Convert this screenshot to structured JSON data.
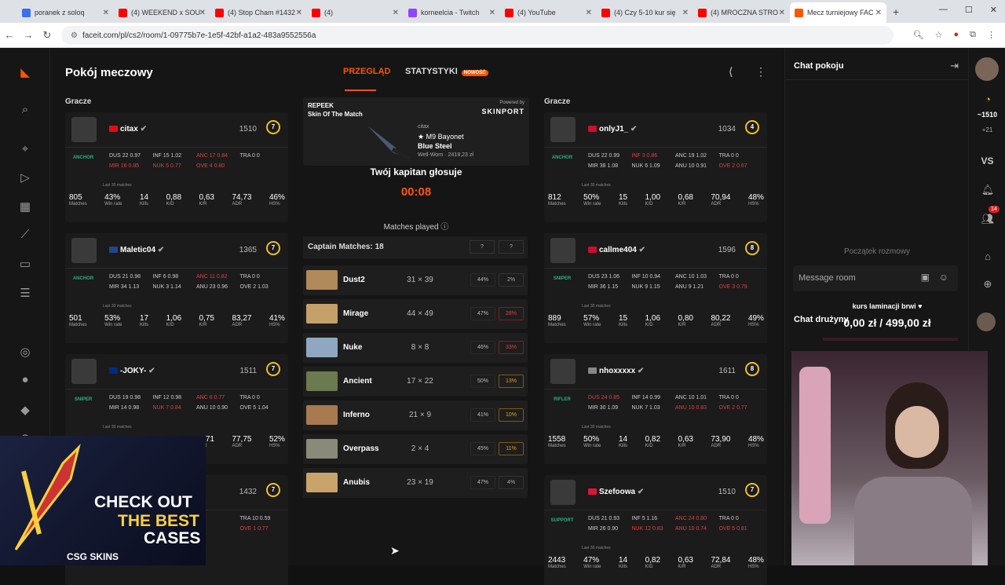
{
  "browser": {
    "tabs": [
      {
        "title": "poranek z soloq",
        "color": "#3b6ef0"
      },
      {
        "title": "(4) WEEKEND x SOU",
        "color": "#ff0000"
      },
      {
        "title": "(4) Stop Cham #1432",
        "color": "#ff0000"
      },
      {
        "title": "(4)",
        "color": "#ff0000"
      },
      {
        "title": "korneelcia - Twitch",
        "color": "#9146ff"
      },
      {
        "title": "(4) YouTube",
        "color": "#ff0000"
      },
      {
        "title": "(4) Czy 5-10 kur się",
        "color": "#ff0000"
      },
      {
        "title": "(4) MROCZNA STRO",
        "color": "#ff0000"
      },
      {
        "title": "Mecz turniejowy FAC",
        "color": "#ff5500"
      }
    ],
    "url": "faceit.com/pl/cs2/room/1-09775b7e-1e5f-42bf-a1a2-483a9552556a"
  },
  "page": {
    "title": "Pokój meczowy",
    "tab_overview": "PRZEGLĄD",
    "tab_stats": "STATYSTYKI",
    "tab_new": "NOWOŚĆ",
    "players_label": "Gracze"
  },
  "team_left": [
    {
      "name": "citax",
      "elo": "1510",
      "level": "7",
      "role": "ANCHOR",
      "flag": "#e30a17",
      "maps": [
        "DUS 22 0.97",
        "INF 15 1.02",
        "ANC 17 0.84",
        "TRA 0 0",
        "MIR 16 0.85",
        "NUK 5 0.77",
        "OVE 4 0.80",
        ""
      ],
      "last": "Last 30 matches",
      "stats": [
        [
          "805",
          "Matches"
        ],
        [
          "43%",
          "Win rate"
        ],
        [
          "14",
          "Kills"
        ],
        [
          "0,88",
          "K/D"
        ],
        [
          "0,63",
          "K/R"
        ],
        [
          "74,73",
          "ADR"
        ],
        [
          "46%",
          "HS%"
        ]
      ]
    },
    {
      "name": "Maletic04",
      "elo": "1365",
      "level": "7",
      "role": "ANCHOR",
      "flag": "#21468b",
      "maps": [
        "DUS 21 0.98",
        "INF 6 0.98",
        "ANC 11 0.82",
        "TRA 0 0",
        "MIR 34 1.13",
        "NUK 3 1.14",
        "ANU 23 0.96",
        "OVE 2 1.03"
      ],
      "last": "Last 30 matches",
      "stats": [
        [
          "501",
          "Matches"
        ],
        [
          "53%",
          "Win rate"
        ],
        [
          "17",
          "Kills"
        ],
        [
          "1,06",
          "K/D"
        ],
        [
          "0,75",
          "K/R"
        ],
        [
          "83,27",
          "ADR"
        ],
        [
          "41%",
          "HS%"
        ]
      ]
    },
    {
      "name": "-JOKY-",
      "elo": "1511",
      "level": "7",
      "role": "SNIPER",
      "flag": "#002b7f",
      "maps": [
        "DUS 19 0.98",
        "INF 12 0.98",
        "ANC 6 0.77",
        "TRA 0 0",
        "MIR 14 0.98",
        "NUK 7 0.84",
        "ANU 10 0.90",
        "OVE 5 1.04"
      ],
      "last": "Last 30 matches",
      "stats": [
        [
          "1247",
          "Matches"
        ],
        [
          "43%",
          "Win rate"
        ],
        [
          "16",
          "Kills"
        ],
        [
          "1,00",
          "K/D"
        ],
        [
          "0,71",
          "K/R"
        ],
        [
          "77,75",
          "ADR"
        ],
        [
          "52%",
          "HS%"
        ]
      ]
    },
    {
      "name": "",
      "elo": "1432",
      "level": "7",
      "role": "",
      "flag": "#333",
      "maps": [
        "",
        "",
        "",
        "TRA 10 0.59",
        "",
        "",
        "",
        "OVE 1 0.77"
      ],
      "last": "",
      "stats": []
    }
  ],
  "team_right": [
    {
      "name": "onlyJ1_",
      "elo": "1034",
      "level": "4",
      "role": "ANCHOR",
      "flag": "#c8102e",
      "maps": [
        "DUS 22 0.99",
        "INF 3 0.86",
        "ANC 19 1.02",
        "TRA 0 0",
        "MIR 38 1.08",
        "NUK 6 1.09",
        "ANU 10 0.91",
        "OVE 2 0.67"
      ],
      "last": "Last 30 matches",
      "stats": [
        [
          "812",
          "Matches"
        ],
        [
          "50%",
          "Win rate"
        ],
        [
          "15",
          "Kills"
        ],
        [
          "1,00",
          "K/D"
        ],
        [
          "0,68",
          "K/R"
        ],
        [
          "70,94",
          "ADR"
        ],
        [
          "48%",
          "HS%"
        ]
      ]
    },
    {
      "name": "callme404",
      "elo": "1596",
      "level": "8",
      "role": "SNIPER",
      "flag": "#c8102e",
      "maps": [
        "DUS 23 1.06",
        "INF 10 0.94",
        "ANC 10 1.03",
        "TRA 0 0",
        "MIR 36 1.15",
        "NUK 9 1.15",
        "ANU 9 1.21",
        "OVE 3 0.79"
      ],
      "last": "Last 30 matches",
      "stats": [
        [
          "889",
          "Matches"
        ],
        [
          "57%",
          "Win rate"
        ],
        [
          "15",
          "Kills"
        ],
        [
          "1,06",
          "K/D"
        ],
        [
          "0,80",
          "K/R"
        ],
        [
          "80,22",
          "ADR"
        ],
        [
          "49%",
          "HS%"
        ]
      ]
    },
    {
      "name": "nhoxxxxx",
      "elo": "1611",
      "level": "8",
      "role": "RIFLER",
      "flag": "#888",
      "maps": [
        "DUS 24 0.85",
        "INF 14 0.99",
        "ANC 10 1.01",
        "TRA 0 0",
        "MIR 30 1.09",
        "NUK 7 1.03",
        "ANU 10 0.83",
        "OVE 2 0.77"
      ],
      "last": "Last 30 matches",
      "stats": [
        [
          "1558",
          "Matches"
        ],
        [
          "50%",
          "Win rate"
        ],
        [
          "14",
          "Kills"
        ],
        [
          "0,82",
          "K/D"
        ],
        [
          "0,63",
          "K/R"
        ],
        [
          "73,90",
          "ADR"
        ],
        [
          "48%",
          "HS%"
        ]
      ]
    },
    {
      "name": "Szefoowa",
      "elo": "1510",
      "level": "7",
      "role": "SUPPORT",
      "flag": "#dc143c",
      "maps": [
        "DUS 21 0.93",
        "INF 5 1.16",
        "ANC 24 0.80",
        "TRA 0 0",
        "MIR 26 0.90",
        "NUK 12 0.83",
        "ANU 10 0.74",
        "OVE 5 0.81"
      ],
      "last": "Last 30 matches",
      "stats": [
        [
          "2443",
          "Matches"
        ],
        [
          "47%",
          "Win rate"
        ],
        [
          "14",
          "Kills"
        ],
        [
          "0,82",
          "K/D"
        ],
        [
          "0,63",
          "K/R"
        ],
        [
          "72,84",
          "ADR"
        ],
        [
          "48%",
          "HS%"
        ]
      ]
    }
  ],
  "skin": {
    "brand": "REPEEK",
    "title": "Skin Of The Match",
    "powered": "Powered by",
    "sponsor": "SKINPORT",
    "owner": "citax",
    "item": "★ M9 Bayonet",
    "finish": "Blue Steel",
    "wear": "Well-Worn · 2418,23 zł"
  },
  "vote": {
    "label": "Twój kapitan głosuje",
    "timer": "00:08"
  },
  "matches_played": "Matches played",
  "captain": {
    "label": "Captain Matches: 18",
    "a": "?",
    "b": "?"
  },
  "maps": [
    {
      "name": "Dust2",
      "score": "31 × 39",
      "win": "44%",
      "ban": "2%",
      "color": "#b08a5a"
    },
    {
      "name": "Mirage",
      "score": "44 × 49",
      "win": "47%",
      "ban": "28%",
      "color": "#c4a16a"
    },
    {
      "name": "Nuke",
      "score": "8 × 8",
      "win": "46%",
      "ban": "33%",
      "color": "#8fa8c0"
    },
    {
      "name": "Ancient",
      "score": "17 × 22",
      "win": "50%",
      "ban": "13%",
      "color": "#6b7a4f"
    },
    {
      "name": "Inferno",
      "score": "21 × 9",
      "win": "41%",
      "ban": "10%",
      "color": "#a87a50"
    },
    {
      "name": "Overpass",
      "score": "2 × 4",
      "win": "45%",
      "ban": "11%",
      "color": "#8a8a7a"
    },
    {
      "name": "Anubis",
      "score": "23 × 19",
      "win": "47%",
      "ban": "4%",
      "color": "#c9a46a"
    }
  ],
  "chat": {
    "title": "Chat pokoju",
    "start": "Początek rozmowy",
    "placeholder": "Message room",
    "team": "Chat drużyny"
  },
  "overlay": {
    "donation_title": "kurs laminacji brwi ♥",
    "donation_amount": "0,00 zł / 499,00 zł",
    "ad_line1": "CHECK OUT",
    "ad_line2": "THE BEST",
    "ad_line3": "CASES",
    "ad_brand": "CSG SKINS"
  },
  "rightbar": {
    "elo": "~1510",
    "delta": "+21",
    "vs": "VS",
    "badge": "14"
  }
}
